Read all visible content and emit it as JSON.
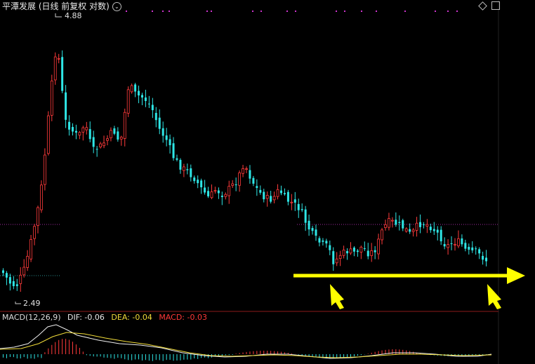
{
  "header": {
    "title": "平潭发展 (日线 前复权 对数)",
    "toggle_glyph": "⌄"
  },
  "price_labels": {
    "high": "4.88",
    "low": "2.49"
  },
  "macd_legend": {
    "label": "MACD(12,26,9)",
    "dif": "DIF: -0.06",
    "dea": "DEA: -0.04",
    "macd": "MACD: -0.03"
  },
  "colors": {
    "up": "#ff3b3b",
    "down": "#2ee6e6",
    "support_line": "#ffff00",
    "grid_dotted": "#cc33cc",
    "divider": "#8b1a1a"
  },
  "icons": [
    "chevron-down-icon",
    "diamond-icon",
    "square-icon",
    "support-arrow-icon",
    "pointer-arrow-icon"
  ]
}
